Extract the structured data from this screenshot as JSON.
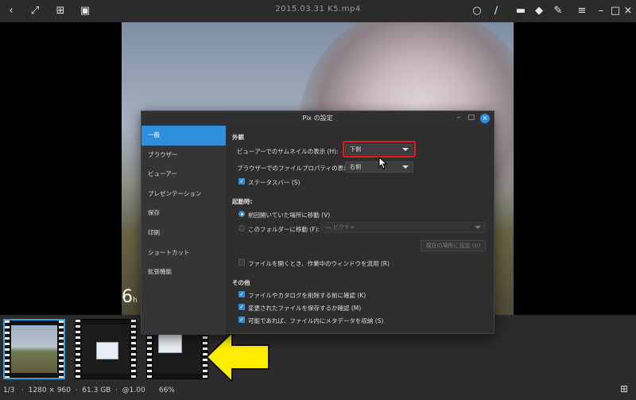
{
  "window": {
    "title": "2015.03.31 K5.mp4"
  },
  "toolbar_icons": [
    "back-icon",
    "fullscreen-icon",
    "image-list-icon",
    "screenshot-icon",
    "lightbulb-icon",
    "brush-icon",
    "comment-icon",
    "tags-icon",
    "wrench-icon",
    "menu-icon",
    "minimize-icon",
    "maximize-icon",
    "close-icon"
  ],
  "viewer": {
    "overlay_number": "6",
    "overlay_unit": "h"
  },
  "status": {
    "text": "1/3   ·  1280 × 960  ·  61.3 GB  ·  @1.00      66%"
  },
  "dialog": {
    "title": "Pix の設定",
    "sidebar": [
      "一般",
      "ブラウザー",
      "ビューアー",
      "プレゼンテーション",
      "保存",
      "印刷",
      "ショートカット",
      "拡張機能"
    ],
    "appearance": {
      "heading": "外観",
      "thumb_label": "ビューアーでのサムネイルの表示 (H):",
      "thumb_value": "下側",
      "props_label": "ブラウザーでのファイルプロパティの表示 (P):",
      "props_value": "右側",
      "statusbar_label": "ステータスバー (S)"
    },
    "startup": {
      "heading": "起動時:",
      "last_label": "前回開いていた場所に移動 (V)",
      "folder_label": "このフォルダーに移動 (F):",
      "folder_value": "ピクチャ",
      "current_button": "現在の場所に設定 (U)",
      "reuse_label": "ファイルを開くとき、作業中のウィンドウを流用 (R)"
    },
    "other": {
      "heading": "その他",
      "confirm_delete": "ファイルやカタログを削除する前に確認 (K)",
      "confirm_save": "変更されたファイルを保存するか確認 (M)",
      "save_metadata": "可能であれば、ファイル内にメタデータを収納 (S)"
    }
  },
  "colors": {
    "accent": "#2f8fdc",
    "highlight": "#e01c1c",
    "arrow": "#ffee00"
  }
}
